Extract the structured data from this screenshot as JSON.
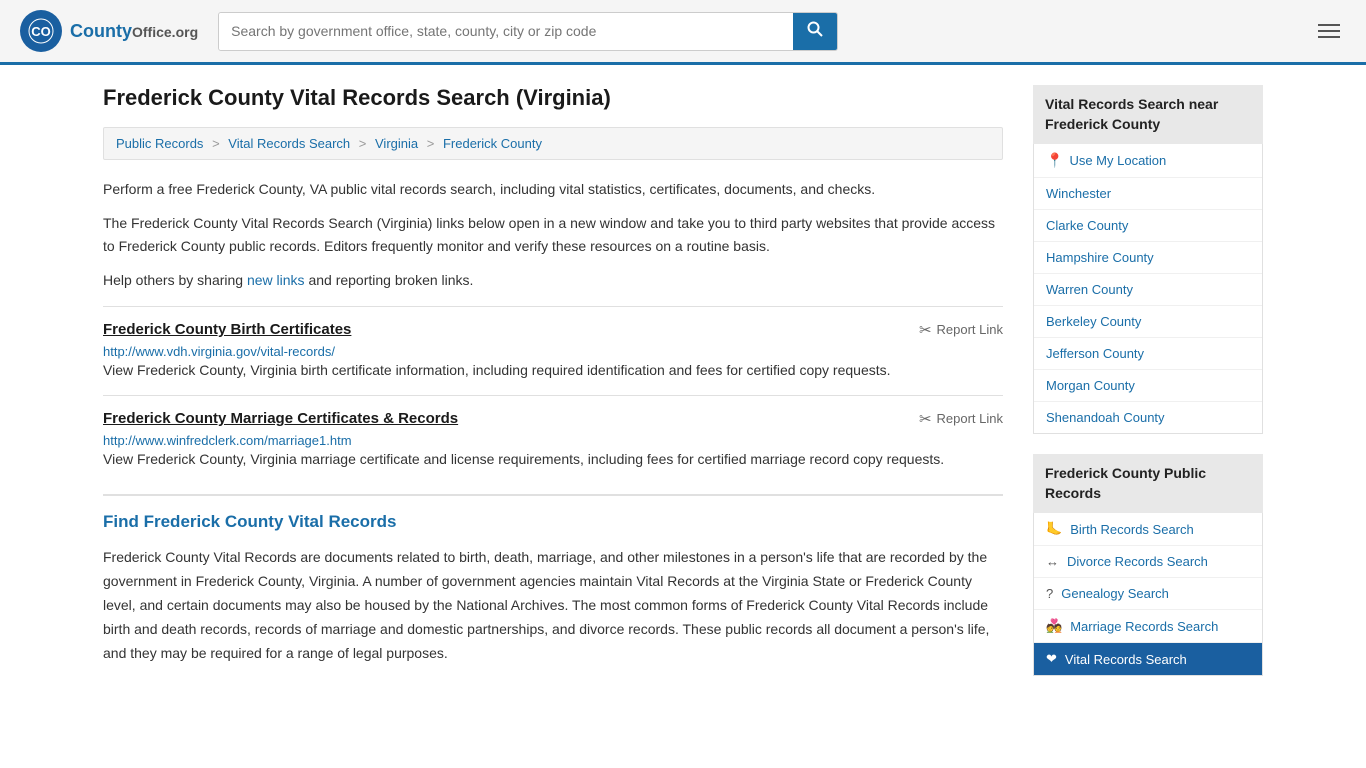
{
  "header": {
    "logo_text": "County",
    "logo_org": "Office.org",
    "search_placeholder": "Search by government office, state, county, city or zip code",
    "logo_icon": "🔍"
  },
  "page": {
    "title": "Frederick County Vital Records Search (Virginia)",
    "breadcrumb": [
      {
        "label": "Public Records",
        "href": "#"
      },
      {
        "label": "Vital Records Search",
        "href": "#"
      },
      {
        "label": "Virginia",
        "href": "#"
      },
      {
        "label": "Frederick County",
        "href": "#"
      }
    ],
    "description1": "Perform a free Frederick County, VA public vital records search, including vital statistics, certificates, documents, and checks.",
    "description2": "The Frederick County Vital Records Search (Virginia) links below open in a new window and take you to third party websites that provide access to Frederick County public records. Editors frequently monitor and verify these resources on a routine basis.",
    "description3_pre": "Help others by sharing ",
    "description3_link": "new links",
    "description3_post": " and reporting broken links.",
    "records": [
      {
        "id": "birth-cert",
        "title": "Frederick County Birth Certificates",
        "url": "http://www.vdh.virginia.gov/vital-records/",
        "description": "View Frederick County, Virginia birth certificate information, including required identification and fees for certified copy requests.",
        "report_label": "Report Link"
      },
      {
        "id": "marriage-cert",
        "title": "Frederick County Marriage Certificates & Records",
        "url": "http://www.winfredclerk.com/marriage1.htm",
        "description": "View Frederick County, Virginia marriage certificate and license requirements, including fees for certified marriage record copy requests.",
        "report_label": "Report Link"
      }
    ],
    "find_section": {
      "title": "Find Frederick County Vital Records",
      "text": "Frederick County Vital Records are documents related to birth, death, marriage, and other milestones in a person's life that are recorded by the government in Frederick County, Virginia. A number of government agencies maintain Vital Records at the Virginia State or Frederick County level, and certain documents may also be housed by the National Archives. The most common forms of Frederick County Vital Records include birth and death records, records of marriage and domestic partnerships, and divorce records. These public records all document a person's life, and they may be required for a range of legal purposes."
    }
  },
  "sidebar": {
    "nearby_title": "Vital Records Search near Frederick County",
    "nearby_links": [
      {
        "label": "Use My Location",
        "icon": "📍",
        "href": "#"
      },
      {
        "label": "Winchester",
        "href": "#"
      },
      {
        "label": "Clarke County",
        "href": "#"
      },
      {
        "label": "Hampshire County",
        "href": "#"
      },
      {
        "label": "Warren County",
        "href": "#"
      },
      {
        "label": "Berkeley County",
        "href": "#"
      },
      {
        "label": "Jefferson County",
        "href": "#"
      },
      {
        "label": "Morgan County",
        "href": "#"
      },
      {
        "label": "Shenandoah County",
        "href": "#"
      }
    ],
    "public_records_title": "Frederick County Public Records",
    "public_records_links": [
      {
        "label": "Birth Records Search",
        "icon": "🦶",
        "href": "#"
      },
      {
        "label": "Divorce Records Search",
        "icon": "↔",
        "href": "#"
      },
      {
        "label": "Genealogy Search",
        "icon": "?",
        "href": "#"
      },
      {
        "label": "Marriage Records Search",
        "icon": "💑",
        "href": "#"
      },
      {
        "label": "Vital Records Search",
        "icon": "❤",
        "href": "#",
        "active": true
      }
    ]
  }
}
